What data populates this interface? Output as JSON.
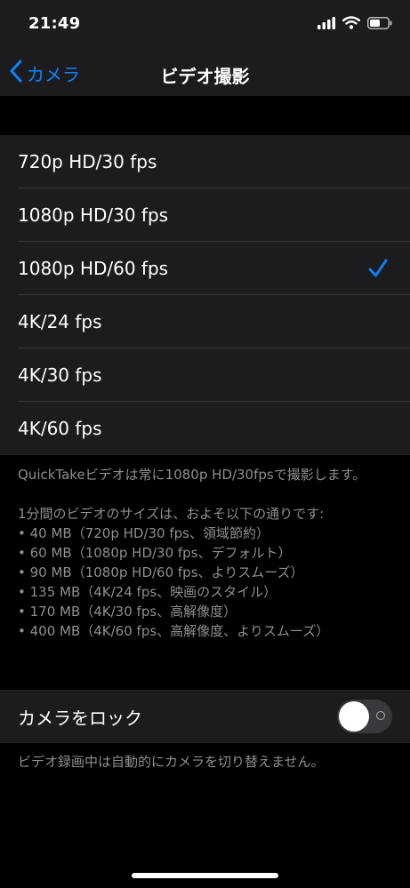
{
  "status_bar": {
    "time": "21:49"
  },
  "nav": {
    "back_label": "カメラ",
    "title": "ビデオ撮影"
  },
  "format_options": [
    {
      "label": "720p HD/30 fps",
      "selected": false
    },
    {
      "label": "1080p HD/30 fps",
      "selected": false
    },
    {
      "label": "1080p HD/60 fps",
      "selected": true
    },
    {
      "label": "4K/24 fps",
      "selected": false
    },
    {
      "label": "4K/30 fps",
      "selected": false
    },
    {
      "label": "4K/60 fps",
      "selected": false
    }
  ],
  "info": {
    "quicktake_note": "QuickTakeビデオは常に1080p HD/30fpsで撮影します。",
    "size_intro": "1分間のビデオのサイズは、およそ以下の通りです:",
    "sizes": [
      "• 40 MB（720p HD/30 fps、領域節約）",
      "• 60 MB（1080p HD/30 fps、デフォルト）",
      "• 90 MB（1080p HD/60 fps、よりスムーズ）",
      "• 135 MB（4K/24 fps、映画のスタイル）",
      "• 170 MB（4K/30 fps、高解像度）",
      "• 400 MB（4K/60 fps、高解像度、よりスムーズ）"
    ]
  },
  "lock_camera": {
    "label": "カメラをロック",
    "enabled": false,
    "footer": "ビデオ録画中は自動的にカメラを切り替えません。"
  },
  "colors": {
    "accent": "#0a84ff",
    "cell_background": "#1c1c1e",
    "page_background": "#000000",
    "secondary_text": "#8e8e93"
  },
  "icons": [
    "signal-icon",
    "wifi-icon",
    "battery-icon",
    "chevron-left-icon",
    "checkmark-icon"
  ]
}
